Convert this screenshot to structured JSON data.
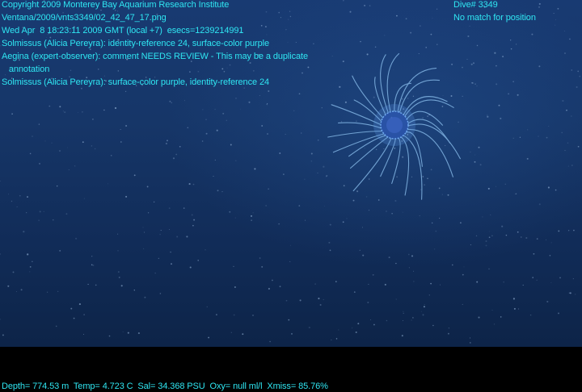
{
  "overlay": {
    "copyright": "Copyright 2009 Monterey Bay Aquarium Research Institute",
    "file_path": "Ventana/2009/vnts3349/02_42_47_17.png",
    "timestamp": "Wed Apr  8 18:23:11 2009 GMT (local +7)  esecs=1239214991",
    "annotation_1": "Solmissus (Alicia Pereyra): identity-reference 24, surface-color purple",
    "annotation_2": "Aegina (expert-observer): comment NEEDS REVIEW - This may be a duplicate",
    "annotation_2_cont": "   annotation",
    "annotation_3": "Solmissus (Alicia Pereyra): surface-color purple, identity-reference 24",
    "dive": "Dive# 3349",
    "position_status": "No match for position",
    "telemetry": "Depth= 774.53 m  Temp= 4.723 C  Sal= 34.368 PSU  Oxy= null ml/l  Xmiss= 85.76%"
  },
  "colors": {
    "overlay_text": "#2fe6f2",
    "water": "#163668",
    "band": "#000000"
  }
}
